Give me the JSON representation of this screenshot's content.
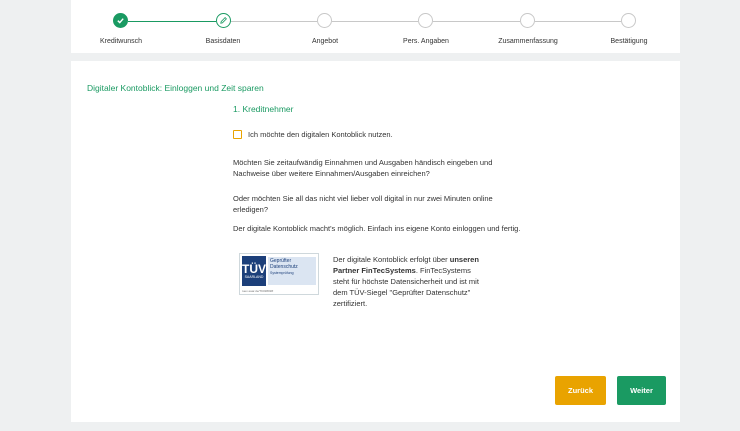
{
  "stepper": {
    "steps": [
      {
        "label": "Kreditwunsch",
        "state": "done"
      },
      {
        "label": "Basisdaten",
        "state": "current"
      },
      {
        "label": "Angebot",
        "state": "pending"
      },
      {
        "label": "Pers. Angaben",
        "state": "pending"
      },
      {
        "label": "Zusammenfassung",
        "state": "pending"
      },
      {
        "label": "Bestätigung",
        "state": "pending"
      }
    ],
    "colors": {
      "active": "#1a9a62",
      "pending": "#c8c8c8"
    }
  },
  "main": {
    "title": "Digitaler Kontoblick: Einloggen und Zeit sparen",
    "section_title": "1. Kreditnehmer",
    "checkbox_label": "Ich möchte den digitalen Kontoblick nutzen.",
    "paragraphs": [
      "Möchten Sie zeitaufwändig Einnahmen und Ausgaben händisch eingeben und Nachweise über weitere Einnahmen/Ausgaben einreichen?",
      "Oder möchten Sie all das nicht viel lieber voll digital in nur zwei Minuten online erledigen?",
      "Der digitale Kontoblick macht's möglich. Einfach ins eigene Konto einloggen und fertig."
    ],
    "tuv": {
      "logo_text": "TÜV",
      "logo_sub": "SAARLAND",
      "line1": "Geprüfter Datenschutz",
      "line2": "Systemprüfung",
      "footer": "tuev-saar.de/TK######"
    },
    "tuv_description": {
      "part1": "Der digitale Kontoblick erfolgt über ",
      "bold": "unseren Partner FinTecSystems",
      "part2": ". FinTecSystems steht für höchste Datensicherheit und ist mit dem TÜV-Siegel \"Geprüfter Datenschutz\" zertifiziert."
    }
  },
  "buttons": {
    "back": "Zurück",
    "next": "Weiter"
  },
  "colors": {
    "accent": "#1a9a62",
    "secondary": "#e9a300",
    "background": "#eef0f1"
  }
}
